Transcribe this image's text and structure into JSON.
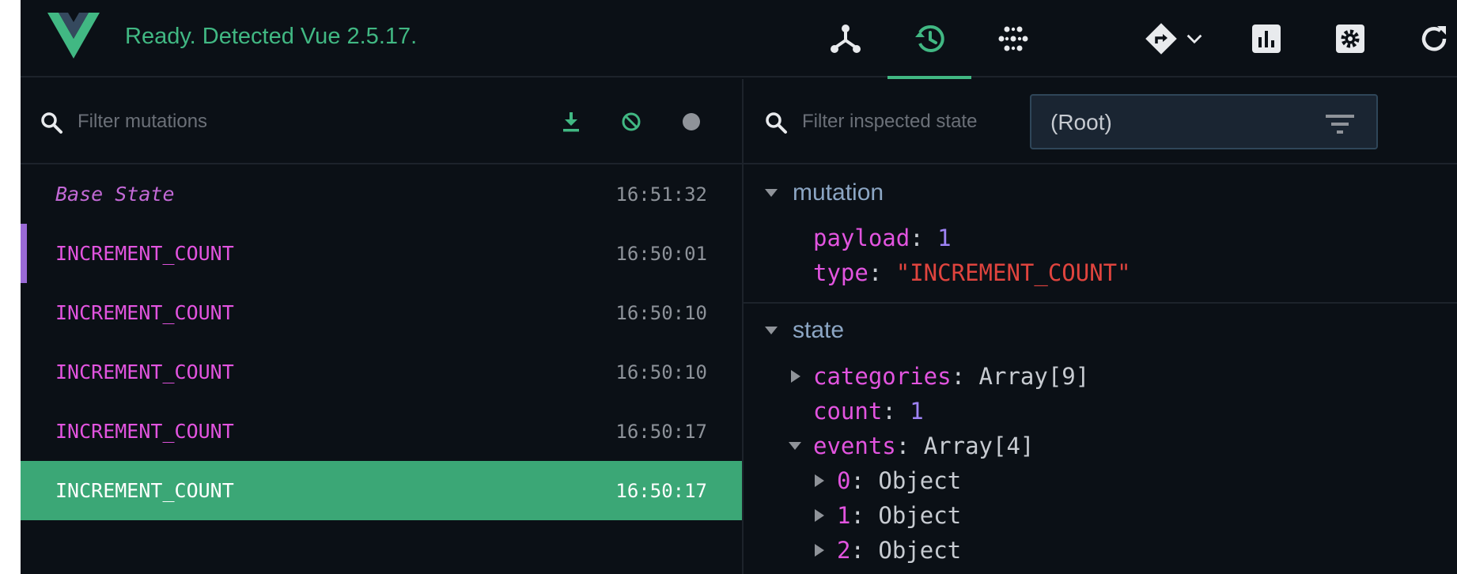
{
  "header": {
    "status": "Ready. Detected Vue 2.5.17.",
    "nav": [
      {
        "id": "components",
        "icon": "component-tree-icon"
      },
      {
        "id": "vuex",
        "icon": "history-icon",
        "active": true
      },
      {
        "id": "events",
        "icon": "events-dots-icon"
      },
      {
        "id": "routing",
        "icon": "routing-icon"
      },
      {
        "id": "performance",
        "icon": "bar-chart-icon"
      },
      {
        "id": "settings",
        "icon": "gear-icon"
      },
      {
        "id": "refresh",
        "icon": "refresh-icon"
      }
    ]
  },
  "mutations_panel": {
    "filter_placeholder": "Filter mutations",
    "rows": [
      {
        "name": "Base State",
        "time": "16:51:32",
        "kind": "base"
      },
      {
        "name": "INCREMENT_COUNT",
        "time": "16:50:01",
        "kind": "inspected"
      },
      {
        "name": "INCREMENT_COUNT",
        "time": "16:50:10",
        "kind": "normal"
      },
      {
        "name": "INCREMENT_COUNT",
        "time": "16:50:10",
        "kind": "normal"
      },
      {
        "name": "INCREMENT_COUNT",
        "time": "16:50:17",
        "kind": "normal"
      },
      {
        "name": "INCREMENT_COUNT",
        "time": "16:50:17",
        "kind": "selected"
      }
    ]
  },
  "inspector": {
    "filter_placeholder": "Filter inspected state",
    "root_select": "(Root)",
    "mutation_section": {
      "title": "mutation",
      "payload_key": "payload",
      "payload_value": "1",
      "type_key": "type",
      "type_value": "\"INCREMENT_COUNT\""
    },
    "state_section": {
      "title": "state",
      "categories_key": "categories",
      "categories_value": "Array[9]",
      "count_key": "count",
      "count_value": "1",
      "events_key": "events",
      "events_value": "Array[4]",
      "event_items": [
        {
          "key": "0",
          "value": "Object"
        },
        {
          "key": "1",
          "value": "Object"
        },
        {
          "key": "2",
          "value": "Object"
        }
      ]
    }
  },
  "colors": {
    "accent": "#41b883",
    "mutation_name": "#e254df",
    "selected_row": "#3ba776",
    "inspected_marker": "#9a6ad6"
  }
}
